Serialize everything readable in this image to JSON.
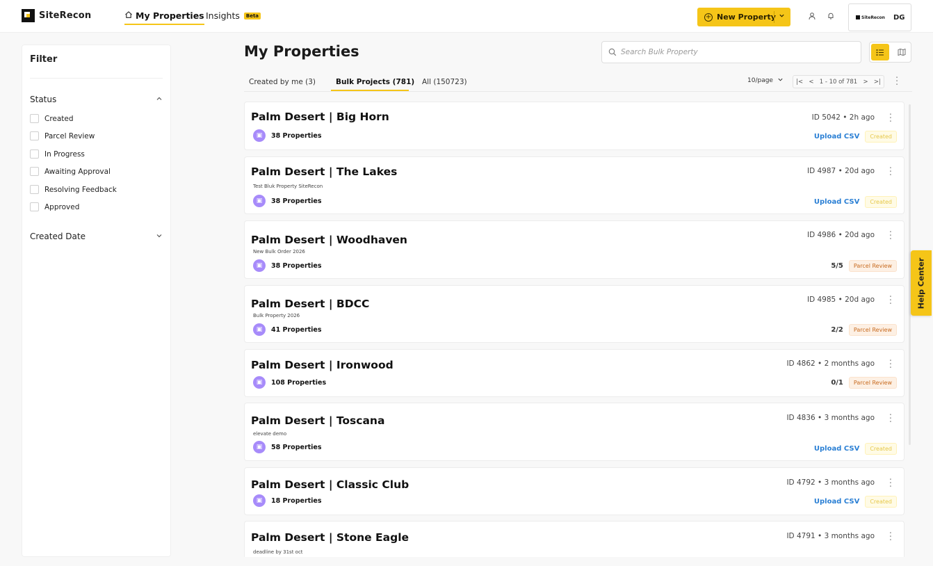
{
  "brand": {
    "name": "SiteRecon"
  },
  "nav": {
    "my_properties": "My Properties",
    "insights": "Insights",
    "insights_badge": "Beta",
    "new_property": "New Property",
    "user_initials": "DG",
    "user_org_logo": "SiteRecon"
  },
  "colors": {
    "accent": "#f5c518",
    "link": "#2a7fd4",
    "purple": "#a78bfa"
  },
  "icons": [
    "home-icon",
    "plus-circle-icon",
    "chevron-down-icon",
    "user-icon",
    "bell-icon",
    "search-icon",
    "list-view-icon",
    "map-view-icon",
    "chevron-up-icon",
    "kebab-icon",
    "first-page-icon",
    "prev-page-icon",
    "next-page-icon",
    "last-page-icon",
    "properties-icon"
  ],
  "filter": {
    "title": "Filter",
    "status_label": "Status",
    "status_options": [
      "Created",
      "Parcel Review",
      "In Progress",
      "Awaiting Approval",
      "Resolving Feedback",
      "Approved"
    ],
    "created_date_label": "Created Date"
  },
  "main": {
    "title": "My Properties",
    "search_placeholder": "Search Bulk Property",
    "tabs": [
      "Created by me (3)",
      "Bulk Projects (781)",
      "All (150723)"
    ],
    "active_tab": 1,
    "page_size": "10/page",
    "page_range": "1 - 10 of 781"
  },
  "projects": [
    {
      "name": "Palm Desert | Big Horn",
      "desc": "",
      "properties": "38 Properties",
      "id": "ID 5042",
      "age": "2h ago",
      "action": "Upload CSV",
      "progress": "",
      "status": "Created"
    },
    {
      "name": "Palm Desert | The Lakes",
      "desc": "Test Bluk Property SiteRecon",
      "properties": "38 Properties",
      "id": "ID 4987",
      "age": "20d ago",
      "action": "Upload CSV",
      "progress": "",
      "status": "Created"
    },
    {
      "name": "Palm Desert | Woodhaven",
      "desc": "New Bulk Order 2026",
      "properties": "38 Properties",
      "id": "ID 4986",
      "age": "20d ago",
      "action": "",
      "progress": "5/5",
      "status": "Parcel Review"
    },
    {
      "name": "Palm Desert | BDCC",
      "desc": "Bulk Property 2026",
      "properties": "41 Properties",
      "id": "ID 4985",
      "age": "20d ago",
      "action": "",
      "progress": "2/2",
      "status": "Parcel Review"
    },
    {
      "name": "Palm Desert | Ironwood",
      "desc": "",
      "properties": "108 Properties",
      "id": "ID 4862",
      "age": "2 months ago",
      "action": "",
      "progress": "0/1",
      "status": "Parcel Review"
    },
    {
      "name": "Palm Desert | Toscana",
      "desc": "elevate demo",
      "properties": "58 Properties",
      "id": "ID 4836",
      "age": "3 months ago",
      "action": "Upload CSV",
      "progress": "",
      "status": "Created"
    },
    {
      "name": "Palm Desert | Classic Club",
      "desc": "",
      "properties": "18 Properties",
      "id": "ID 4792",
      "age": "3 months ago",
      "action": "Upload CSV",
      "progress": "",
      "status": "Created"
    },
    {
      "name": "Palm Desert | Stone Eagle",
      "desc": "deadline by 31st oct",
      "properties": "",
      "id": "ID 4791",
      "age": "3 months ago",
      "action": "",
      "progress": "",
      "status": ""
    }
  ],
  "help_center": "Help Center"
}
